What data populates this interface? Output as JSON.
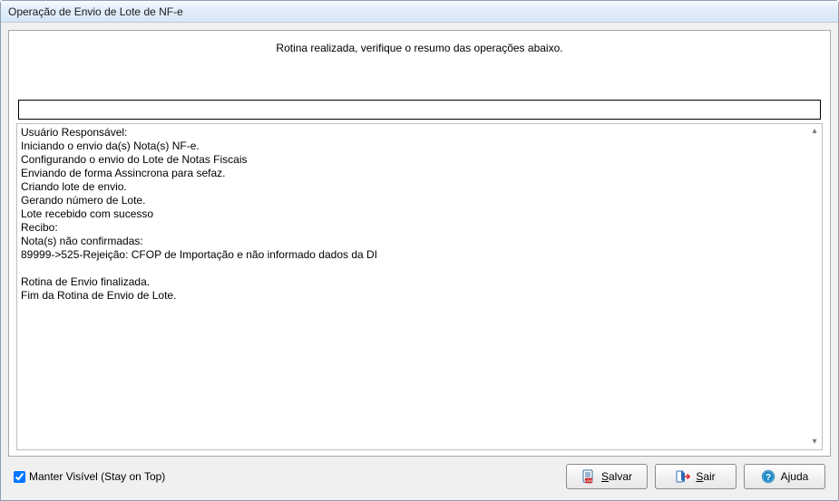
{
  "window": {
    "title": "Operação de Envio de Lote de NF-e"
  },
  "status": {
    "message": "Rotina realizada, verifique o resumo das operações abaixo."
  },
  "log": {
    "text": "Usuário Responsável:\nIniciando o envio da(s) Nota(s) NF-e.\nConfigurando o envio do Lote de Notas Fiscais\nEnviando de forma Assincrona para sefaz.\nCriando lote de envio.\nGerando número de Lote.\nLote recebido com sucesso\nRecibo:\nNota(s) não confirmadas:\n89999->525-Rejeição: CFOP de Importação e não informado dados da DI\n\nRotina de Envio finalizada.\nFim da Rotina de Envio de Lote."
  },
  "footer": {
    "stay_on_top_label": "Manter Visível (Stay on Top)",
    "stay_on_top_checked": true,
    "save_label": "Salvar",
    "exit_label": "Sair",
    "help_label": "Ajuda"
  }
}
